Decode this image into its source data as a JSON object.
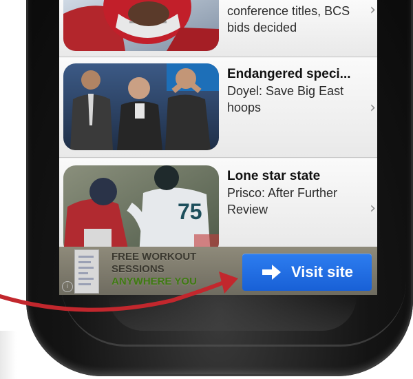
{
  "feed": {
    "stories": [
      {
        "headline": "",
        "summary": "conference titles, BCS bids decided"
      },
      {
        "headline": "Endangered speci...",
        "summary": "Doyel: Save Big East hoops"
      },
      {
        "headline": "Lone star state",
        "summary": "Prisco: After Further Review"
      }
    ],
    "chevron": "›"
  },
  "ad": {
    "line1": "FREE WORKOUT",
    "line2": "SESSIONS",
    "line3": "ANYWHERE YOU",
    "button_label": "Visit site",
    "button_color": "#1e6ee0",
    "info_glyph": "i"
  },
  "icons": {
    "visit_arrow": "arrow-right-icon",
    "callout": "red-callout-arrow"
  },
  "colors": {
    "callout_red": "#c2272d",
    "phone_body": "#111111"
  }
}
